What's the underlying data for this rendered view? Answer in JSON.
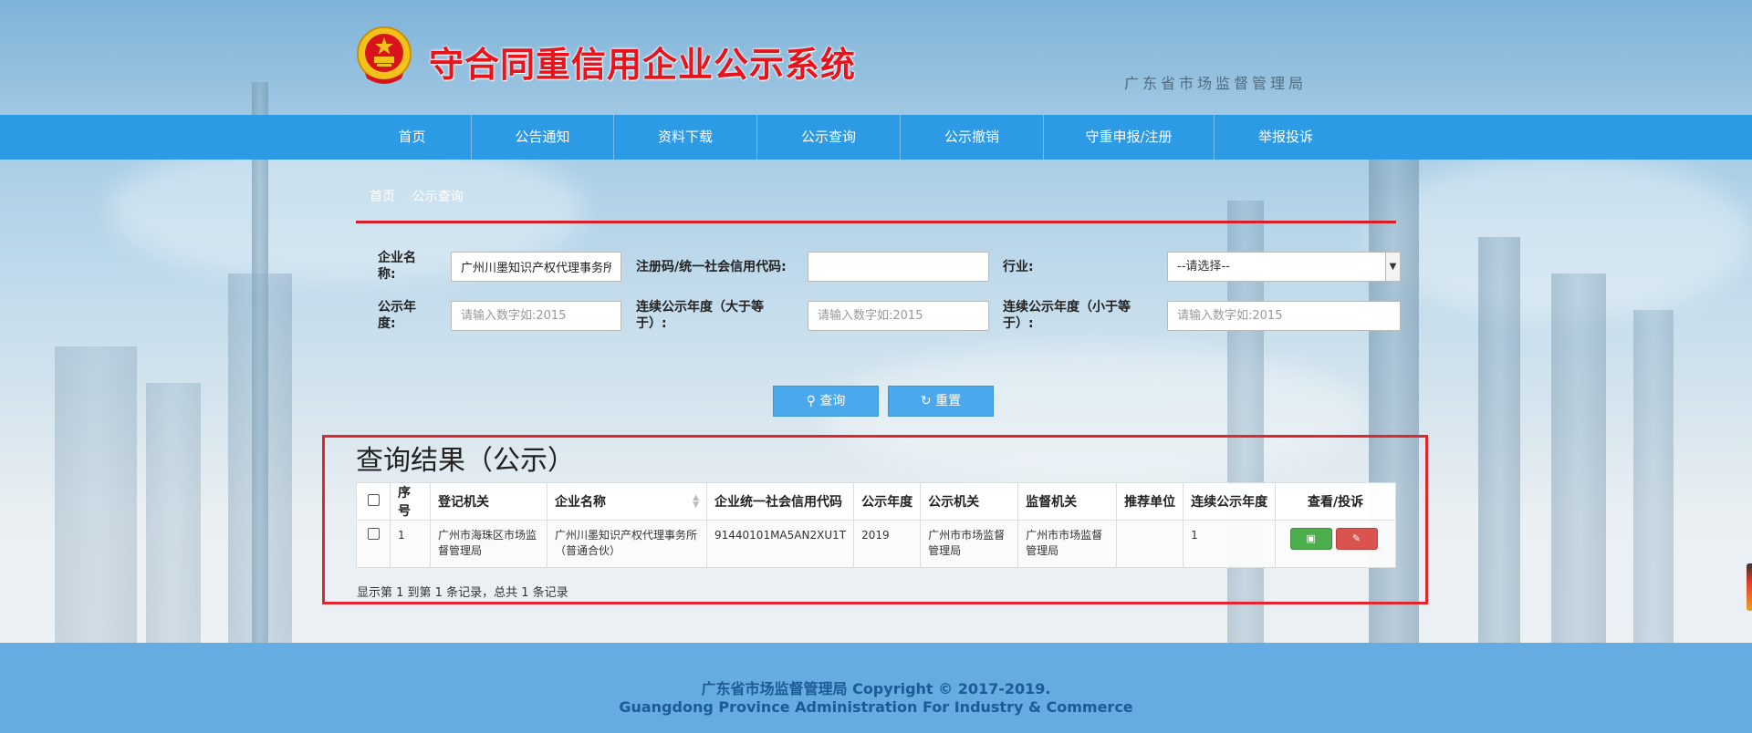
{
  "header": {
    "site_title": "守合同重信用企业公示系统",
    "bureau": "广东省市场监督管理局"
  },
  "nav": {
    "items": [
      {
        "label": "首页"
      },
      {
        "label": "公告通知"
      },
      {
        "label": "资料下载"
      },
      {
        "label": "公示查询"
      },
      {
        "label": "公示撤销"
      },
      {
        "label": "守重申报/注册"
      },
      {
        "label": "举报投诉"
      }
    ]
  },
  "breadcrumb": {
    "home": "首页",
    "separator": "/",
    "current": "公示查询"
  },
  "form": {
    "company_name_label": "企业名称:",
    "company_name_value": "广州川墨知识产权代理事务所",
    "reg_code_label": "注册码/统一社会信用代码:",
    "reg_code_value": "",
    "industry_label": "行业:",
    "industry_selected": "--请选择--",
    "year_label": "公示年度:",
    "year_placeholder": "请输入数字如:2015",
    "cont_year_ge_label": "连续公示年度（大于等于）:",
    "cont_year_ge_placeholder": "请输入数字如:2015",
    "cont_year_le_label": "连续公示年度（小于等于）:",
    "cont_year_le_placeholder": "请输入数字如:2015",
    "search_button": "查询",
    "reset_button": "重置"
  },
  "results": {
    "title": "查询结果（公示）",
    "columns": [
      "序号",
      "登记机关",
      "企业名称",
      "企业统一社会信用代码",
      "公示年度",
      "公示机关",
      "监督机关",
      "推荐单位",
      "连续公示年度",
      "查看/投诉"
    ],
    "rows": [
      {
        "index": "1",
        "reg_authority": "广州市海珠区市场监督管理局",
        "company": "广州川墨知识产权代理事务所（普通合伙）",
        "credit_code": "91440101MA5AN2XU1T",
        "year": "2019",
        "publish_authority": "广州市市场监督管理局",
        "supervisor": "广州市市场监督管理局",
        "recommender": "",
        "consecutive_years": "1"
      }
    ],
    "summary": "显示第 1 到第 1 条记录，总共 1 条记录"
  },
  "footer": {
    "line1": "广东省市场监督管理局 Copyright © 2017-2019.",
    "line2": "Guangdong Province Administration For Industry & Commerce"
  },
  "colors": {
    "nav_bg": "#2d9ae6",
    "title_red": "#e8141c",
    "highlight_border": "#e1272d",
    "footer_bg": "#64ace2"
  }
}
